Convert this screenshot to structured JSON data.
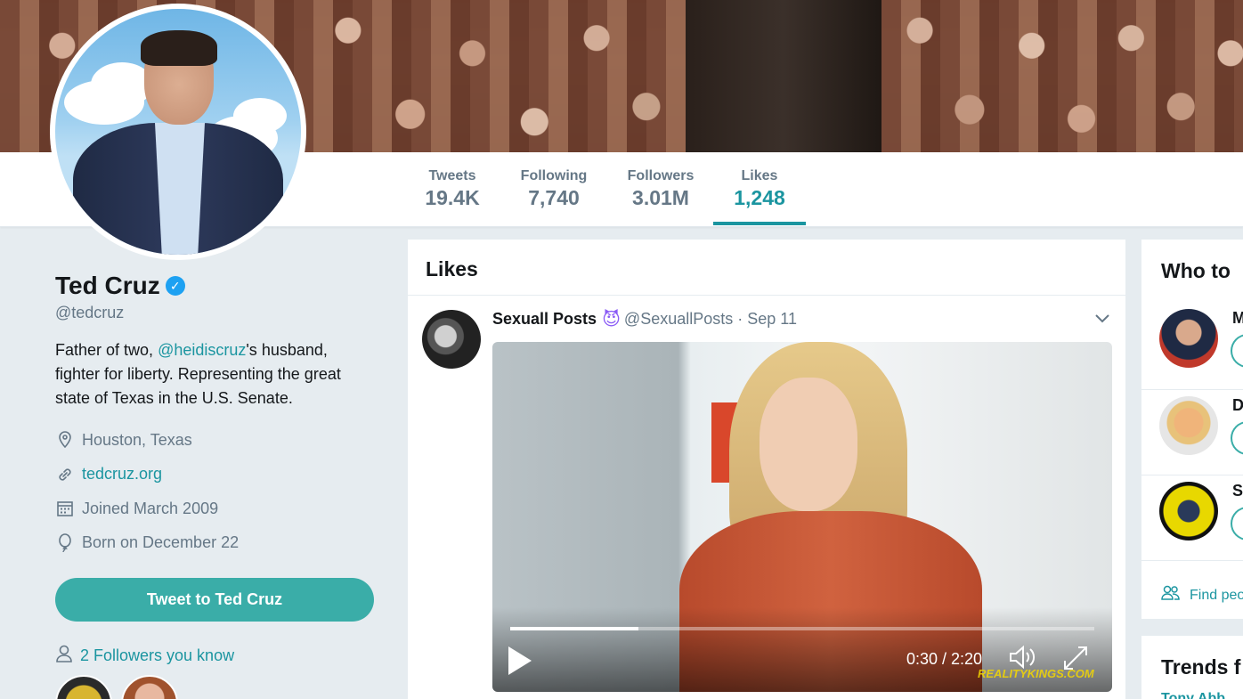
{
  "stats": [
    {
      "label": "Tweets",
      "value": "19.4K"
    },
    {
      "label": "Following",
      "value": "7,740"
    },
    {
      "label": "Followers",
      "value": "3.01M"
    },
    {
      "label": "Likes",
      "value": "1,248"
    }
  ],
  "profile": {
    "name": "Ted Cruz",
    "handle": "@tedcruz",
    "bio_pre": "Father of two, ",
    "bio_mention": "@heidiscruz",
    "bio_post": "'s husband, fighter for liberty. Representing the great state of Texas in the U.S. Senate.",
    "location": "Houston, Texas",
    "website": "tedcruz.org",
    "joined": "Joined March 2009",
    "born": "Born on December 22",
    "tweet_to": "Tweet to Ted Cruz",
    "followers_you_know": "2 Followers you know"
  },
  "timeline": {
    "title": "Likes",
    "tweet": {
      "display_name": "Sexuall Posts",
      "emoji": "😈",
      "handle": "@SexuallPosts",
      "separator": "·",
      "date": "Sep 11",
      "video_time": "0:30 / 2:20",
      "video_progress": 0.22,
      "watermark": "REALITYKINGS.COM"
    }
  },
  "sidebar": {
    "who_to_follow": "Who to",
    "suggestions": [
      {
        "initial": "M"
      },
      {
        "initial": "D"
      },
      {
        "initial": "S"
      }
    ],
    "find_people": "Find peo",
    "trends_title": "Trends f",
    "trend_1": "Tony Abb"
  },
  "colors": {
    "accent": "#1b95a0",
    "button": "#3aada8"
  }
}
